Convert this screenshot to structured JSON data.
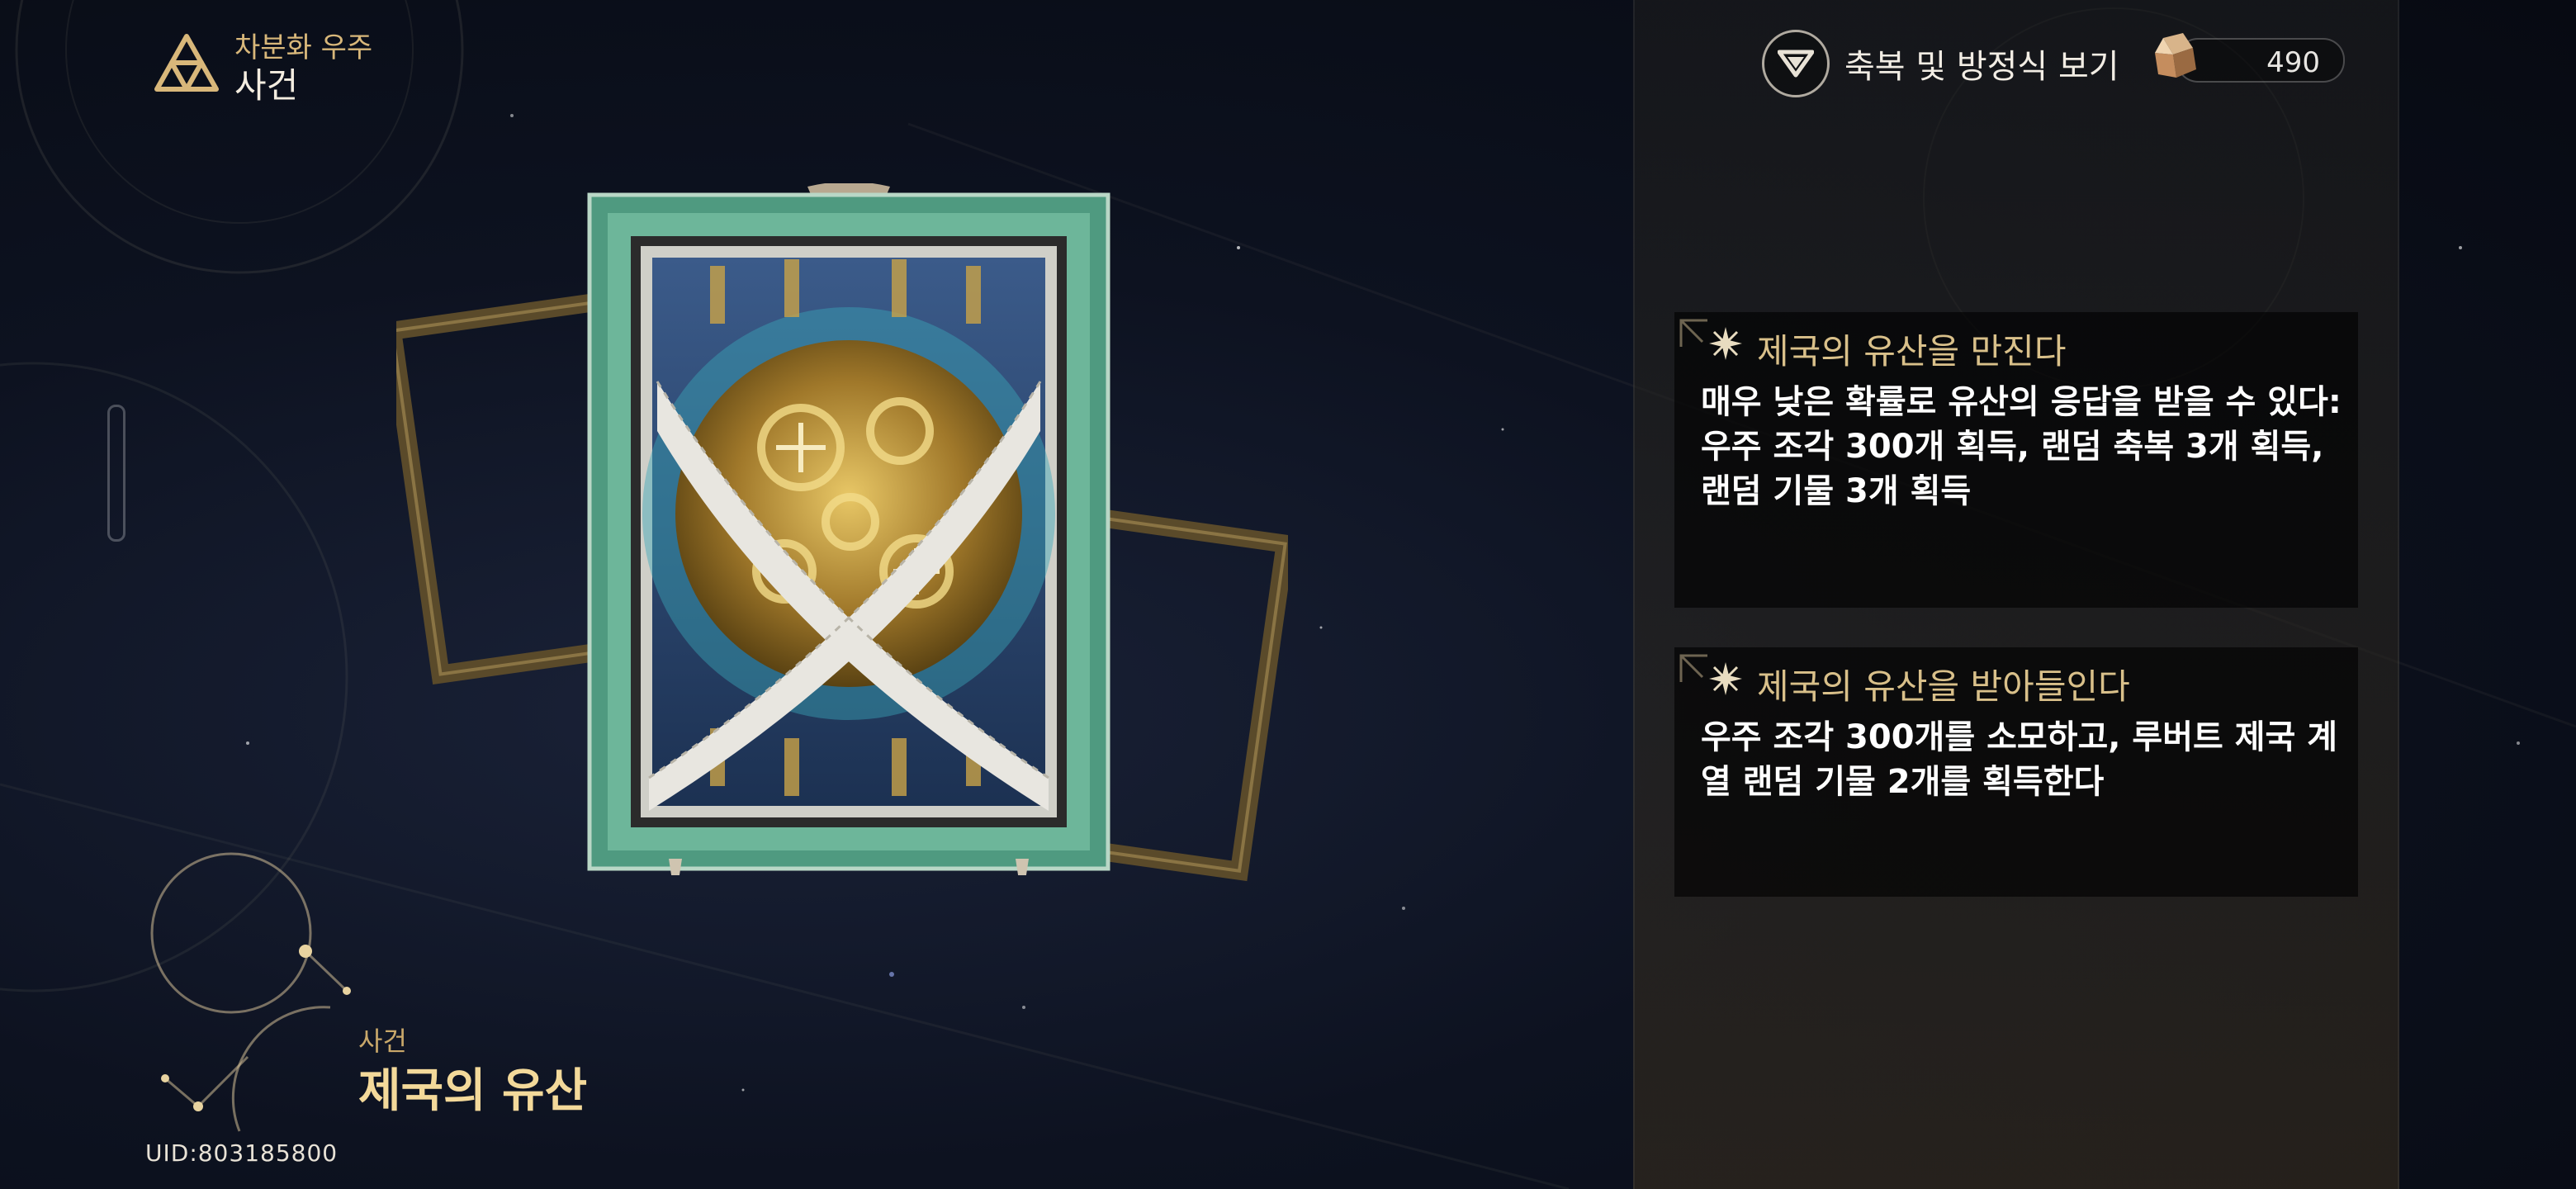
{
  "header": {
    "subtitle": "차분화 우주",
    "title": "사건"
  },
  "toolbar": {
    "blessing_label": "축복 및 방정식 보기"
  },
  "currency": {
    "value": "490",
    "icon": "cosmic-fragment-icon"
  },
  "options": [
    {
      "title": "제국의 유산을 만진다",
      "description": "매우 낮은 확률로 유산의 응답을 받을 수 있다: 우주 조각 300개 획득, 랜덤 축복 3개 획득, 랜덤 기물 3개 획득"
    },
    {
      "title": "제국의 유산을 받아들인다",
      "description": "우주 조각 300개를 소모하고, 루버트 제국 계열 랜덤 기물 2개를 획득한다"
    }
  ],
  "event": {
    "category": "사건",
    "name": "제국의 유산"
  },
  "uid": "UID:803185800",
  "colors": {
    "gold": "#d9c08a",
    "card_frame": "#5fa58a",
    "panel": "#1e1e1e"
  }
}
